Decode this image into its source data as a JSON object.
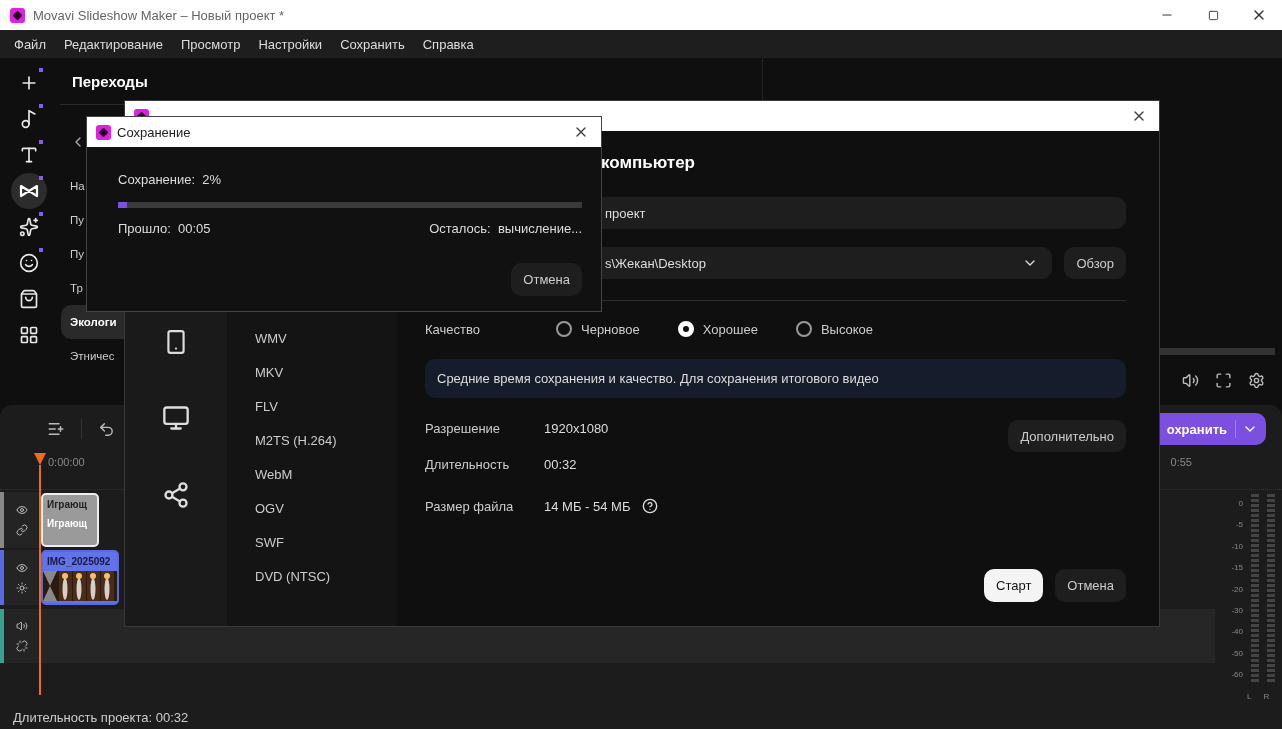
{
  "window": {
    "title": "Movavi Slideshow Maker – Новый проект *"
  },
  "menu": [
    "Файл",
    "Редактирование",
    "Просмотр",
    "Настройки",
    "Сохранить",
    "Справка"
  ],
  "tools": [
    {
      "kind": "add",
      "selected": false,
      "badge": true
    },
    {
      "kind": "music",
      "selected": false,
      "badge": true
    },
    {
      "kind": "text",
      "selected": false,
      "badge": true
    },
    {
      "kind": "transitions",
      "selected": true,
      "badge": true
    },
    {
      "kind": "effects",
      "selected": false,
      "badge": true
    },
    {
      "kind": "stickers",
      "selected": false,
      "badge": true
    },
    {
      "kind": "store",
      "selected": false,
      "badge": false
    },
    {
      "kind": "more",
      "selected": false,
      "badge": false
    }
  ],
  "panel": {
    "title": "Переходы",
    "items": [
      {
        "label": "На",
        "selected": false
      },
      {
        "label": "Пу",
        "selected": false
      },
      {
        "label": "Пу",
        "selected": false
      },
      {
        "label": "Тр",
        "selected": false
      },
      {
        "label": "Экологи",
        "selected": true
      },
      {
        "label": "Этничес",
        "selected": false
      }
    ]
  },
  "timeline": {
    "save_button": "охранить",
    "start_time": "0:00:00",
    "end_time": "0:55",
    "tracks": [
      {
        "kind": "text",
        "clips": [
          "Играющ",
          "Играющ"
        ]
      },
      {
        "kind": "video",
        "clips": [
          "IMG_2025092"
        ]
      },
      {
        "kind": "audio"
      }
    ],
    "meter_scale": [
      "0",
      "-5",
      "-10",
      "-15",
      "-20",
      "-30",
      "-40",
      "-50",
      "-60"
    ],
    "channels": [
      "L",
      "R"
    ]
  },
  "status_bar": "Длительность проекта: 00:32",
  "export_dialog": {
    "heading": "компьютер",
    "file_name": "проект",
    "folder": "s\\Жекан\\Desktop",
    "browse_button": "Обзор",
    "targets": [
      {
        "kind": "phone"
      },
      {
        "kind": "monitor"
      },
      {
        "kind": "share"
      }
    ],
    "formats": [
      "WMV",
      "MKV",
      "FLV",
      "M2TS (H.264)",
      "WebM",
      "OGV",
      "SWF",
      "DVD (NTSC)"
    ],
    "quality_label": "Качество",
    "quality_options": [
      {
        "label": "Черновое",
        "selected": false
      },
      {
        "label": "Хорошее",
        "selected": true
      },
      {
        "label": "Высокое",
        "selected": false
      }
    ],
    "info": "Средние время сохранения и качество. Для сохранения итогового видео",
    "properties": [
      {
        "label": "Разрешение",
        "value": "1920x1080",
        "help": false
      },
      {
        "label": "Длительность",
        "value": "00:32",
        "help": false
      },
      {
        "label": "Размер файла",
        "value": "14 МБ - 54 МБ",
        "help": true
      }
    ],
    "advanced_button": "Дополнительно",
    "buttons": [
      {
        "label": "Старт",
        "kind": "primary"
      },
      {
        "label": "Отмена",
        "kind": "secondary"
      }
    ]
  },
  "progress_dialog": {
    "title": "Сохранение",
    "status_label": "Сохранение:",
    "percent": "2%",
    "level": 0.02,
    "elapsed_label": "Прошло:",
    "elapsed": "00:05",
    "remaining_label": "Осталось:",
    "remaining": "вычисление...",
    "cancel_button": "Отмена"
  }
}
